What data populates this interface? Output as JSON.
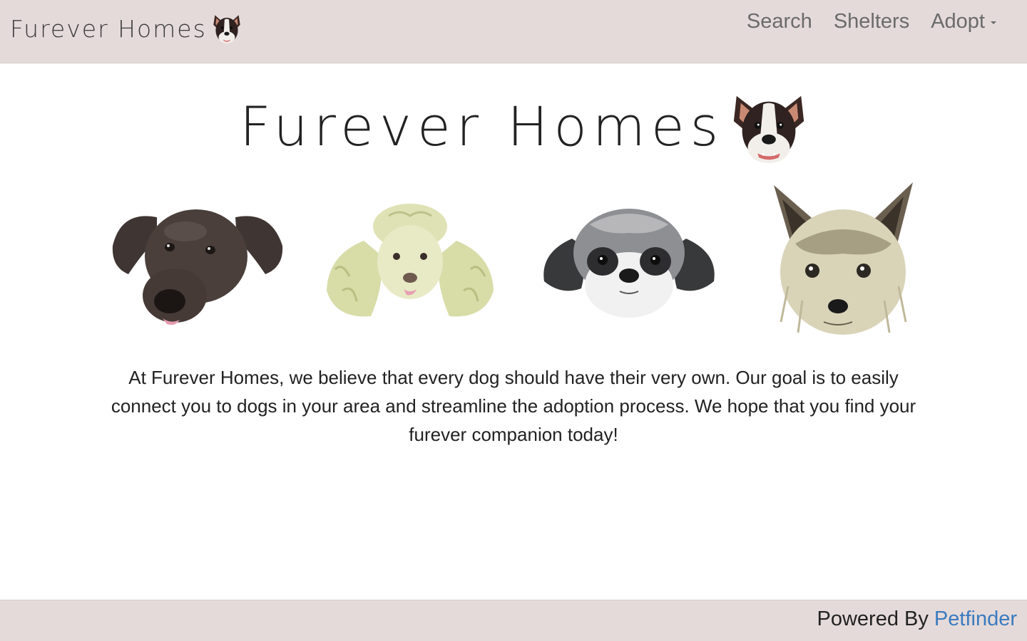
{
  "navbar": {
    "brand_text": "Furever Homes",
    "brand_icon": "boston-terrier-icon",
    "links": [
      {
        "label": "Search"
      },
      {
        "label": "Shelters"
      },
      {
        "label": "Adopt",
        "has_dropdown": true
      }
    ]
  },
  "hero": {
    "title": "Furever Homes",
    "title_icon": "boston-terrier-icon",
    "dogs": [
      {
        "icon": "labrador-illustration"
      },
      {
        "icon": "poodle-illustration"
      },
      {
        "icon": "shih-tzu-illustration"
      },
      {
        "icon": "yorkie-illustration"
      }
    ]
  },
  "intro": {
    "text": "At Furever Homes, we believe that every dog should have their very own. Our goal is to easily connect you to dogs in your area and streamline the adoption process. We hope that you find your furever companion today!"
  },
  "footer": {
    "prefix": "Powered By",
    "link_label": "Petfinder"
  },
  "colors": {
    "bar_background": "#e5dada",
    "nav_text": "#6b6b6b",
    "link_blue": "#3a7bbf"
  }
}
